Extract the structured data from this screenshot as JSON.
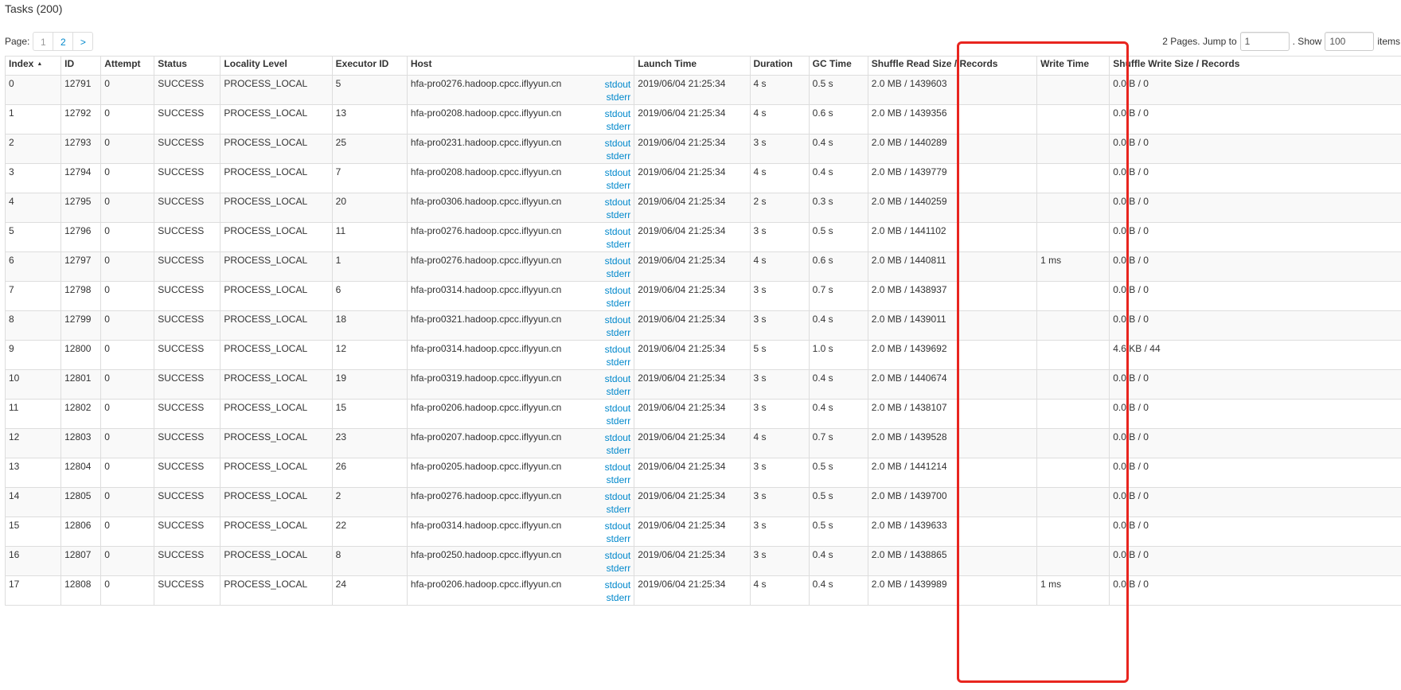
{
  "title": "Tasks (200)",
  "pager": {
    "label": "Page:",
    "pages": [
      "1",
      "2"
    ],
    "next": ">",
    "info_text": "2 Pages. Jump to",
    "jump_value": "1",
    "show_text": ". Show",
    "show_value": "100",
    "items_text": "items"
  },
  "columns": [
    "Index",
    "ID",
    "Attempt",
    "Status",
    "Locality Level",
    "Executor ID",
    "Host",
    "Launch Time",
    "Duration",
    "GC Time",
    "Shuffle Read Size / Records",
    "Write Time",
    "Shuffle Write Size / Records"
  ],
  "log_links": {
    "stdout": "stdout",
    "stderr": "stderr"
  },
  "rows": [
    {
      "index": "0",
      "id": "12791",
      "attempt": "0",
      "status": "SUCCESS",
      "locality": "PROCESS_LOCAL",
      "executor": "5",
      "host": "hfa-pro0276.hadoop.cpcc.iflyyun.cn",
      "launch": "2019/06/04 21:25:34",
      "duration": "4 s",
      "gc": "0.5 s",
      "shuffle_read": "2.0 MB / 1439603",
      "write_time": "",
      "shuffle_write": "0.0 B / 0"
    },
    {
      "index": "1",
      "id": "12792",
      "attempt": "0",
      "status": "SUCCESS",
      "locality": "PROCESS_LOCAL",
      "executor": "13",
      "host": "hfa-pro0208.hadoop.cpcc.iflyyun.cn",
      "launch": "2019/06/04 21:25:34",
      "duration": "4 s",
      "gc": "0.6 s",
      "shuffle_read": "2.0 MB / 1439356",
      "write_time": "",
      "shuffle_write": "0.0 B / 0"
    },
    {
      "index": "2",
      "id": "12793",
      "attempt": "0",
      "status": "SUCCESS",
      "locality": "PROCESS_LOCAL",
      "executor": "25",
      "host": "hfa-pro0231.hadoop.cpcc.iflyyun.cn",
      "launch": "2019/06/04 21:25:34",
      "duration": "3 s",
      "gc": "0.4 s",
      "shuffle_read": "2.0 MB / 1440289",
      "write_time": "",
      "shuffle_write": "0.0 B / 0"
    },
    {
      "index": "3",
      "id": "12794",
      "attempt": "0",
      "status": "SUCCESS",
      "locality": "PROCESS_LOCAL",
      "executor": "7",
      "host": "hfa-pro0208.hadoop.cpcc.iflyyun.cn",
      "launch": "2019/06/04 21:25:34",
      "duration": "4 s",
      "gc": "0.4 s",
      "shuffle_read": "2.0 MB / 1439779",
      "write_time": "",
      "shuffle_write": "0.0 B / 0"
    },
    {
      "index": "4",
      "id": "12795",
      "attempt": "0",
      "status": "SUCCESS",
      "locality": "PROCESS_LOCAL",
      "executor": "20",
      "host": "hfa-pro0306.hadoop.cpcc.iflyyun.cn",
      "launch": "2019/06/04 21:25:34",
      "duration": "2 s",
      "gc": "0.3 s",
      "shuffle_read": "2.0 MB / 1440259",
      "write_time": "",
      "shuffle_write": "0.0 B / 0"
    },
    {
      "index": "5",
      "id": "12796",
      "attempt": "0",
      "status": "SUCCESS",
      "locality": "PROCESS_LOCAL",
      "executor": "11",
      "host": "hfa-pro0276.hadoop.cpcc.iflyyun.cn",
      "launch": "2019/06/04 21:25:34",
      "duration": "3 s",
      "gc": "0.5 s",
      "shuffle_read": "2.0 MB / 1441102",
      "write_time": "",
      "shuffle_write": "0.0 B / 0"
    },
    {
      "index": "6",
      "id": "12797",
      "attempt": "0",
      "status": "SUCCESS",
      "locality": "PROCESS_LOCAL",
      "executor": "1",
      "host": "hfa-pro0276.hadoop.cpcc.iflyyun.cn",
      "launch": "2019/06/04 21:25:34",
      "duration": "4 s",
      "gc": "0.6 s",
      "shuffle_read": "2.0 MB / 1440811",
      "write_time": "1 ms",
      "shuffle_write": "0.0 B / 0"
    },
    {
      "index": "7",
      "id": "12798",
      "attempt": "0",
      "status": "SUCCESS",
      "locality": "PROCESS_LOCAL",
      "executor": "6",
      "host": "hfa-pro0314.hadoop.cpcc.iflyyun.cn",
      "launch": "2019/06/04 21:25:34",
      "duration": "3 s",
      "gc": "0.7 s",
      "shuffle_read": "2.0 MB / 1438937",
      "write_time": "",
      "shuffle_write": "0.0 B / 0"
    },
    {
      "index": "8",
      "id": "12799",
      "attempt": "0",
      "status": "SUCCESS",
      "locality": "PROCESS_LOCAL",
      "executor": "18",
      "host": "hfa-pro0321.hadoop.cpcc.iflyyun.cn",
      "launch": "2019/06/04 21:25:34",
      "duration": "3 s",
      "gc": "0.4 s",
      "shuffle_read": "2.0 MB / 1439011",
      "write_time": "",
      "shuffle_write": "0.0 B / 0"
    },
    {
      "index": "9",
      "id": "12800",
      "attempt": "0",
      "status": "SUCCESS",
      "locality": "PROCESS_LOCAL",
      "executor": "12",
      "host": "hfa-pro0314.hadoop.cpcc.iflyyun.cn",
      "launch": "2019/06/04 21:25:34",
      "duration": "5 s",
      "gc": "1.0 s",
      "shuffle_read": "2.0 MB / 1439692",
      "write_time": "",
      "shuffle_write": "4.6 KB / 44"
    },
    {
      "index": "10",
      "id": "12801",
      "attempt": "0",
      "status": "SUCCESS",
      "locality": "PROCESS_LOCAL",
      "executor": "19",
      "host": "hfa-pro0319.hadoop.cpcc.iflyyun.cn",
      "launch": "2019/06/04 21:25:34",
      "duration": "3 s",
      "gc": "0.4 s",
      "shuffle_read": "2.0 MB / 1440674",
      "write_time": "",
      "shuffle_write": "0.0 B / 0"
    },
    {
      "index": "11",
      "id": "12802",
      "attempt": "0",
      "status": "SUCCESS",
      "locality": "PROCESS_LOCAL",
      "executor": "15",
      "host": "hfa-pro0206.hadoop.cpcc.iflyyun.cn",
      "launch": "2019/06/04 21:25:34",
      "duration": "3 s",
      "gc": "0.4 s",
      "shuffle_read": "2.0 MB / 1438107",
      "write_time": "",
      "shuffle_write": "0.0 B / 0"
    },
    {
      "index": "12",
      "id": "12803",
      "attempt": "0",
      "status": "SUCCESS",
      "locality": "PROCESS_LOCAL",
      "executor": "23",
      "host": "hfa-pro0207.hadoop.cpcc.iflyyun.cn",
      "launch": "2019/06/04 21:25:34",
      "duration": "4 s",
      "gc": "0.7 s",
      "shuffle_read": "2.0 MB / 1439528",
      "write_time": "",
      "shuffle_write": "0.0 B / 0"
    },
    {
      "index": "13",
      "id": "12804",
      "attempt": "0",
      "status": "SUCCESS",
      "locality": "PROCESS_LOCAL",
      "executor": "26",
      "host": "hfa-pro0205.hadoop.cpcc.iflyyun.cn",
      "launch": "2019/06/04 21:25:34",
      "duration": "3 s",
      "gc": "0.5 s",
      "shuffle_read": "2.0 MB / 1441214",
      "write_time": "",
      "shuffle_write": "0.0 B / 0"
    },
    {
      "index": "14",
      "id": "12805",
      "attempt": "0",
      "status": "SUCCESS",
      "locality": "PROCESS_LOCAL",
      "executor": "2",
      "host": "hfa-pro0276.hadoop.cpcc.iflyyun.cn",
      "launch": "2019/06/04 21:25:34",
      "duration": "3 s",
      "gc": "0.5 s",
      "shuffle_read": "2.0 MB / 1439700",
      "write_time": "",
      "shuffle_write": "0.0 B / 0"
    },
    {
      "index": "15",
      "id": "12806",
      "attempt": "0",
      "status": "SUCCESS",
      "locality": "PROCESS_LOCAL",
      "executor": "22",
      "host": "hfa-pro0314.hadoop.cpcc.iflyyun.cn",
      "launch": "2019/06/04 21:25:34",
      "duration": "3 s",
      "gc": "0.5 s",
      "shuffle_read": "2.0 MB / 1439633",
      "write_time": "",
      "shuffle_write": "0.0 B / 0"
    },
    {
      "index": "16",
      "id": "12807",
      "attempt": "0",
      "status": "SUCCESS",
      "locality": "PROCESS_LOCAL",
      "executor": "8",
      "host": "hfa-pro0250.hadoop.cpcc.iflyyun.cn",
      "launch": "2019/06/04 21:25:34",
      "duration": "3 s",
      "gc": "0.4 s",
      "shuffle_read": "2.0 MB / 1438865",
      "write_time": "",
      "shuffle_write": "0.0 B / 0"
    },
    {
      "index": "17",
      "id": "12808",
      "attempt": "0",
      "status": "SUCCESS",
      "locality": "PROCESS_LOCAL",
      "executor": "24",
      "host": "hfa-pro0206.hadoop.cpcc.iflyyun.cn",
      "launch": "2019/06/04 21:25:34",
      "duration": "4 s",
      "gc": "0.4 s",
      "shuffle_read": "2.0 MB / 1439989",
      "write_time": "1 ms",
      "shuffle_write": "0.0 B / 0"
    }
  ],
  "colors": {
    "link": "#0088cc",
    "highlight": "#e8251f",
    "border": "#dddddd",
    "stripe": "#f9f9f9"
  },
  "icons": {
    "sort": "sort-ascending-icon"
  }
}
